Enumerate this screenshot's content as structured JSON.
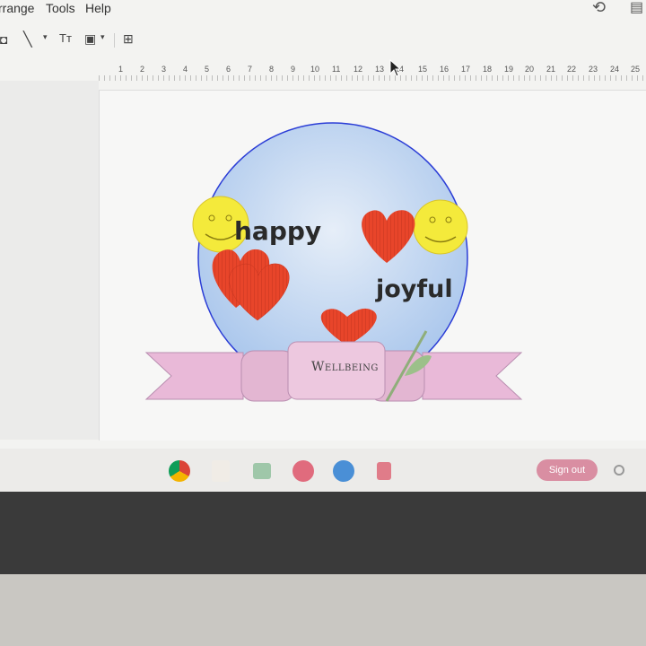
{
  "menubar": {
    "items": [
      "rrange",
      "Tools",
      "Help"
    ]
  },
  "toolbar": {
    "text_tool": "Tт"
  },
  "ruler": {
    "marks": [
      "1",
      "2",
      "3",
      "4",
      "5",
      "6",
      "7",
      "8",
      "9",
      "10",
      "11",
      "12",
      "13",
      "14",
      "15",
      "16",
      "17",
      "18",
      "19",
      "20",
      "21",
      "22",
      "23",
      "24",
      "25"
    ]
  },
  "slide": {
    "word_happy": "happy",
    "word_joyful": "joyful",
    "banner_label": "Wellbeing",
    "colors": {
      "circle_fill": "#b9d1ee",
      "circle_stroke": "#2b3dd6",
      "heart": "#e8452a",
      "smiley": "#f4ea3b",
      "ribbon": "#e9b9d8"
    }
  },
  "shelf": {
    "signout_label": "Sign out"
  }
}
